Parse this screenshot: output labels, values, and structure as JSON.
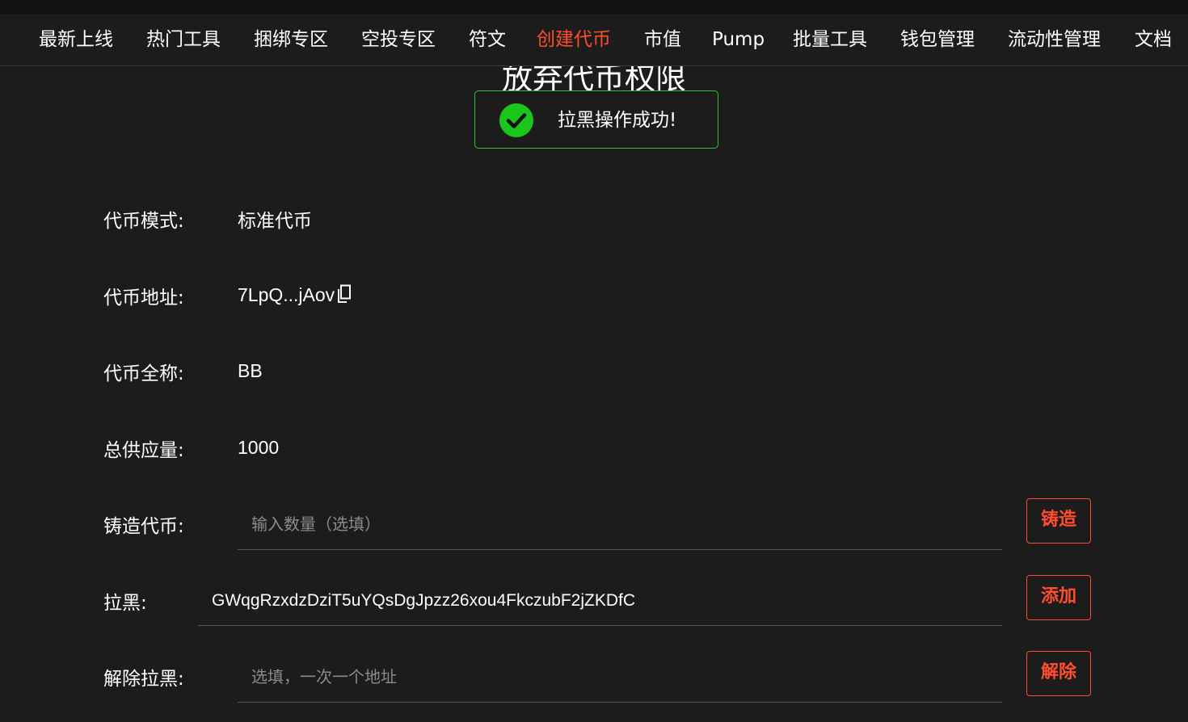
{
  "nav": {
    "items": [
      {
        "label": "最新上线"
      },
      {
        "label": "热门工具"
      },
      {
        "label": "捆绑专区"
      },
      {
        "label": "空投专区"
      },
      {
        "label": "符文"
      },
      {
        "label": "创建代币"
      },
      {
        "label": "市值"
      },
      {
        "label": "Pump"
      },
      {
        "label": "批量工具"
      },
      {
        "label": "钱包管理"
      },
      {
        "label": "流动性管理"
      },
      {
        "label": "文档"
      }
    ],
    "active_label": "创建代币"
  },
  "page": {
    "title": "放弃代币权限"
  },
  "toast": {
    "message": "拉黑操作成功!",
    "icon": "check-circle-icon"
  },
  "info": {
    "mode_label": "代币模式:",
    "mode_value": "标准代币",
    "address_label": "代币地址:",
    "address_value": "7LpQ...jAov",
    "fullname_label": "代币全称:",
    "fullname_value": "BB",
    "supply_label": "总供应量:",
    "supply_value": "1000"
  },
  "mint": {
    "label": "铸造代币:",
    "placeholder": "输入数量（选填）",
    "value": "",
    "button": "铸造"
  },
  "blacklist": {
    "label": "拉黑:",
    "placeholder": "",
    "value": "GWqgRzxdzDziT5uYQsDgJpzz26xou4FkczubF2jZKDfC",
    "button": "添加"
  },
  "unblacklist": {
    "label": "解除拉黑:",
    "placeholder": "选填，一次一个地址",
    "value": "",
    "button": "解除"
  },
  "colors": {
    "background": "#1c1c1c",
    "accent": "#ff4d2e",
    "success": "#19c619"
  }
}
